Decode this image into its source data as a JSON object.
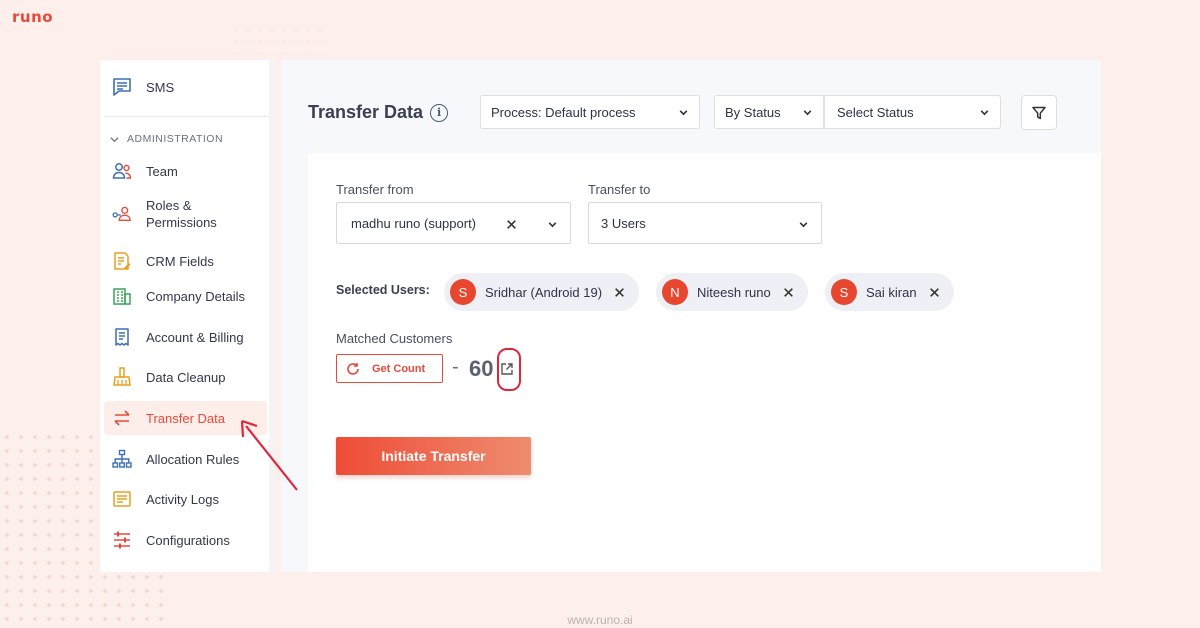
{
  "brand": {
    "logo_text": "runo",
    "footer_url": "www.runo.ai"
  },
  "colors": {
    "accent": "#e34b3b",
    "avatar": "#e8472f",
    "highlight": "#e0263b"
  },
  "sidebar": {
    "top_item": {
      "label": "SMS",
      "icon": "message-icon"
    },
    "section_label": "ADMINISTRATION",
    "items": [
      {
        "label": "Team",
        "icon": "team-icon"
      },
      {
        "label": "Roles &\nPermissions",
        "icon": "roles-icon"
      },
      {
        "label": "CRM Fields",
        "icon": "crm-fields-icon"
      },
      {
        "label": "Company Details",
        "icon": "company-icon"
      },
      {
        "label": "Account & Billing",
        "icon": "billing-icon"
      },
      {
        "label": "Data Cleanup",
        "icon": "broom-icon"
      },
      {
        "label": "Transfer Data",
        "icon": "transfer-icon",
        "active": true
      },
      {
        "label": "Allocation Rules",
        "icon": "hierarchy-icon"
      },
      {
        "label": "Activity Logs",
        "icon": "logs-icon"
      },
      {
        "label": "Configurations",
        "icon": "sliders-icon"
      }
    ]
  },
  "header": {
    "title": "Transfer Data",
    "process_select": "Process: Default process",
    "status_type_select": "By Status",
    "status_select": "Select Status"
  },
  "form": {
    "transfer_from_label": "Transfer from",
    "transfer_from_value": "madhu runo (support)",
    "transfer_to_label": "Transfer to",
    "transfer_to_value": "3 Users",
    "selected_users_label": "Selected Users:",
    "selected_users": [
      {
        "initial": "S",
        "name": "Sridhar (Android 19)"
      },
      {
        "initial": "N",
        "name": "Niteesh runo"
      },
      {
        "initial": "S",
        "name": "Sai kiran"
      }
    ],
    "matched_customers_label": "Matched Customers",
    "get_count_label": "Get Count",
    "count_separator": "-",
    "count_value": "60",
    "initiate_label": "Initiate Transfer"
  }
}
